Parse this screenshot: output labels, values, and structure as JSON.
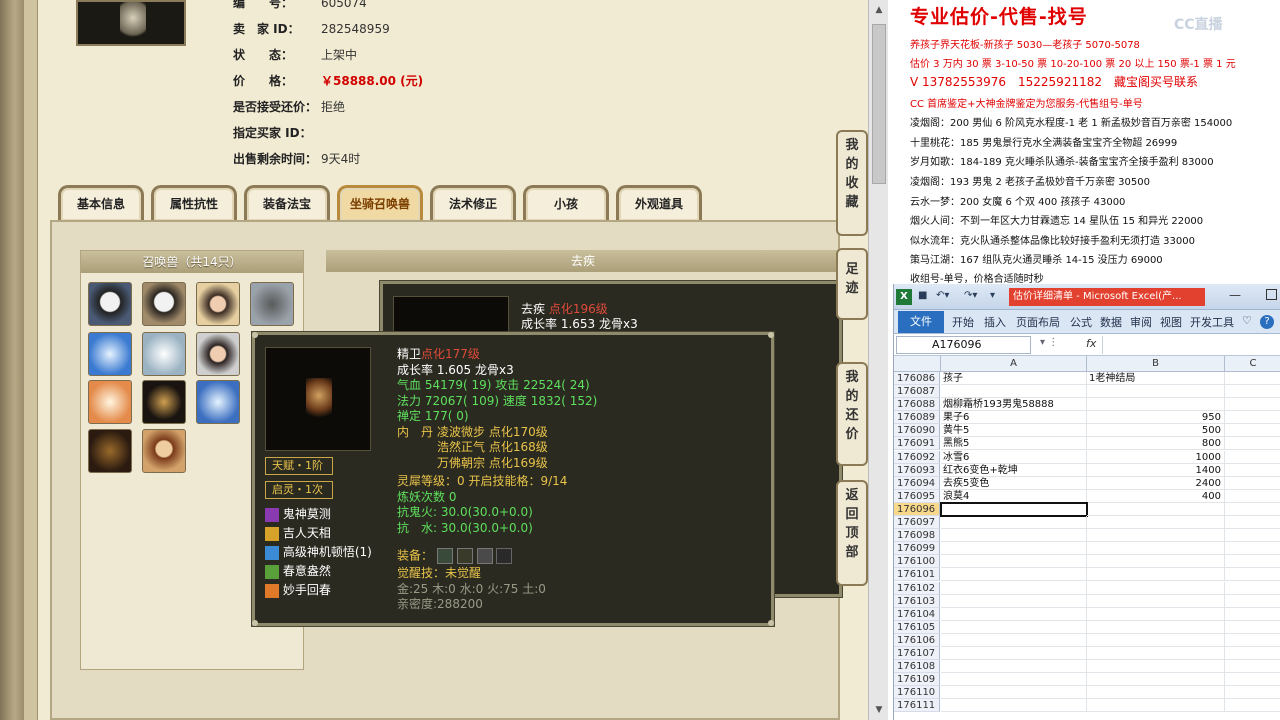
{
  "listing": {
    "rows": [
      {
        "label": "编　　号：",
        "value": "605074"
      },
      {
        "label": "卖　家 ID：",
        "value": "282548959"
      },
      {
        "label": "状　　态：",
        "value": "上架中"
      },
      {
        "label": "价　　格：",
        "value": "￥58888.00 (元)"
      },
      {
        "label": "是否接受还价：",
        "value": "拒绝"
      },
      {
        "label": "指定买家 ID：",
        "value": ""
      },
      {
        "label": "出售剩余时间：",
        "value": "9天4时"
      }
    ]
  },
  "tabs": [
    "基本信息",
    "属性抗性",
    "装备法宝",
    "坐骑召唤兽",
    "法术修正",
    "小孩",
    "外观道具"
  ],
  "active_tab": "坐骑召唤兽",
  "pets": {
    "header": "召唤兽（共14只）",
    "detail_header": "去疾"
  },
  "popup_back": {
    "name": "去疾",
    "level": "点化196级",
    "growth": "成长率 1.653 龙骨x3"
  },
  "popup": {
    "name": "精卫",
    "level": "点化177级",
    "growth": "成长率 1.605 龙骨x3",
    "hp": "气血 54179( 19) 攻击 22524( 24)",
    "mp": "法力 72067( 109) 速度 1832( 152)",
    "ding": "禅定 177( 0)",
    "neidan_label": "内　丹",
    "neidan": [
      "凌波微步 点化170级",
      "浩然正气 点化168级",
      "万佛朝宗 点化169级"
    ],
    "lingxi": "灵犀等级：0 开启技能格：9/14",
    "lianyao": "炼妖次数 0",
    "kang_gui": "抗鬼火: 30.0(30.0+0.0)",
    "kang_shui": "抗　水: 30.0(30.0+0.0)",
    "equip_label": "装备：",
    "awaken": "觉醒技：未觉醒",
    "elements": "金:25 木:0 水:0 火:75 土:0",
    "intimacy": "亲密度:288200",
    "talent": "天赋・1阶",
    "qiling": "启灵・1次",
    "skills": [
      "鬼神莫测",
      "吉人天相",
      "高级神机顿悟(1)",
      "春意盎然",
      "妙手回春"
    ]
  },
  "side_buttons": [
    "我的收藏",
    "足迹",
    "我的还价",
    "返回顶部"
  ],
  "ad": {
    "title": "专业估价-代售-找号",
    "lines_red": [
      "养孩子界天花板-新孩子 5030—老孩子 5070-5078",
      "估价 3 万内 30 票 3-10-50 票 10-20-100 票 20 以上 150 票-1 票 1 元",
      "V 13782553976　15225921182　藏宝阁买号联系",
      "CC 首席鉴定+大神金牌鉴定为您服务-代售组号-单号"
    ],
    "lines": [
      "凌烟阁：200 男仙 6 阶风克水程度-1 老 1 新孟极妙音百万亲密 154000",
      "十里桃花：185 男鬼景行克水全满装备宝宝齐全物超 26999",
      "岁月如歌：184-189 克火睡杀队通杀-装备宝宝齐全接手盈利 83000",
      "凌烟阁：193 男鬼 2 老孩子孟极妙音千万亲密 30500",
      "云水一梦：200 女魔 6 个双 400 孩孩子 43000",
      "烟火人间：不到一年区大力甘霖遗忘 14 星队伍 15 和异光 22000",
      "似水流年：克火队通杀整体品像比较好接手盈利无须打造 33000",
      "策马江湖：167 组队克火通灵睡杀 14-15 没压力 69000",
      "收组号-单号，价格合适随时秒"
    ],
    "watermark": "CC直播"
  },
  "excel": {
    "title": "估价详细清单 - Microsoft Excel(产...",
    "file_tab": "文件",
    "ribbon_tabs": [
      "开始",
      "插入",
      "页面布局",
      "公式",
      "数据",
      "审阅",
      "视图",
      "开发工具"
    ],
    "name_box": "A176096",
    "fx": "fx",
    "columns": [
      "A",
      "B",
      "C"
    ],
    "rows": [
      {
        "n": "176086",
        "a": "孩子",
        "b": "1老神结局",
        "b_text": true
      },
      {
        "n": "176087",
        "a": "",
        "b": ""
      },
      {
        "n": "176088",
        "a": "烟柳霜桥193男鬼58888",
        "b": ""
      },
      {
        "n": "176089",
        "a": "果子6",
        "b": "950"
      },
      {
        "n": "176090",
        "a": "黄牛5",
        "b": "500"
      },
      {
        "n": "176091",
        "a": "黑熊5",
        "b": "800"
      },
      {
        "n": "176092",
        "a": "冰雪6",
        "b": "1000"
      },
      {
        "n": "176093",
        "a": "红衣6变色+乾坤",
        "b": "1400"
      },
      {
        "n": "176094",
        "a": "去疾5变色",
        "b": "2400"
      },
      {
        "n": "176095",
        "a": "浪莫4",
        "b": "400"
      },
      {
        "n": "176096",
        "a": "",
        "b": ""
      },
      {
        "n": "176097",
        "a": "",
        "b": ""
      },
      {
        "n": "176098",
        "a": "",
        "b": ""
      },
      {
        "n": "176099",
        "a": "",
        "b": ""
      },
      {
        "n": "176100",
        "a": "",
        "b": ""
      },
      {
        "n": "176101",
        "a": "",
        "b": ""
      },
      {
        "n": "176102",
        "a": "",
        "b": ""
      },
      {
        "n": "176103",
        "a": "",
        "b": ""
      },
      {
        "n": "176104",
        "a": "",
        "b": ""
      },
      {
        "n": "176105",
        "a": "",
        "b": ""
      },
      {
        "n": "176106",
        "a": "",
        "b": ""
      },
      {
        "n": "176107",
        "a": "",
        "b": ""
      },
      {
        "n": "176108",
        "a": "",
        "b": ""
      },
      {
        "n": "176109",
        "a": "",
        "b": ""
      },
      {
        "n": "176110",
        "a": "",
        "b": ""
      },
      {
        "n": "176111",
        "a": "",
        "b": ""
      }
    ]
  },
  "colors": {
    "price_red": "#d10000",
    "level_red": "#e04a3a",
    "stat_green": "#5ee05e",
    "gold": "#e8c34a",
    "ad_red": "#e00000",
    "excel_file": "#2a6fbf",
    "excel_title_bar": "#e3412f"
  }
}
